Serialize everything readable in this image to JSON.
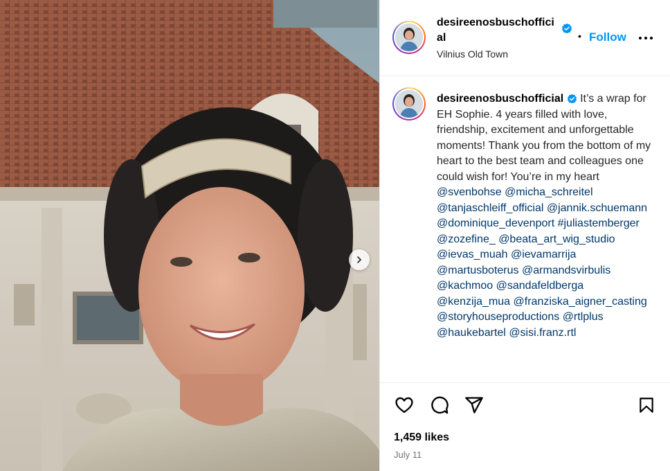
{
  "post": {
    "username": "desireenosbuschofficial",
    "username_wrapped": "desireenosbuschofficial",
    "location": "Vilnius Old Town",
    "follow_label": "Follow",
    "separator": "•"
  },
  "caption": {
    "username": "desireenosbuschofficial",
    "text": "It’s a wrap for EH Sophie. 4 years filled with love, friendship, excitement and unforgettable moments! Thank you from the bottom of my heart to the best team and colleagues one could wish for! You’re in my heart",
    "mentions": [
      "@svenbohse",
      "@micha_schreitel",
      "@tanjaschleiff_official",
      "@jannik.schuemann",
      "@dominique_devenport",
      "#juliastemberger",
      "@zozefine_",
      "@beata_art_wig_studio",
      "@ievas_muah",
      "@ievamarrija",
      "@martusboterus",
      "@armandsvirbulis",
      "@kachmoo",
      "@sandafeldberga",
      "@kenzija_mua",
      "@franziska_aigner_casting",
      "@storyhouseproductions",
      "@rtlplus",
      "@haukebartel",
      "@sisi.franz.rtl"
    ]
  },
  "stats": {
    "likes": "1,459 likes",
    "date": "July 11"
  },
  "icons": {
    "verified": "verified-badge-icon",
    "more": "more-options-icon",
    "like": "heart-icon",
    "comment": "comment-icon",
    "share": "paper-plane-icon",
    "save": "bookmark-icon",
    "next": "chevron-right-icon"
  },
  "colors": {
    "accent": "#0095f6",
    "mention": "#00376b",
    "muted": "#737373"
  }
}
